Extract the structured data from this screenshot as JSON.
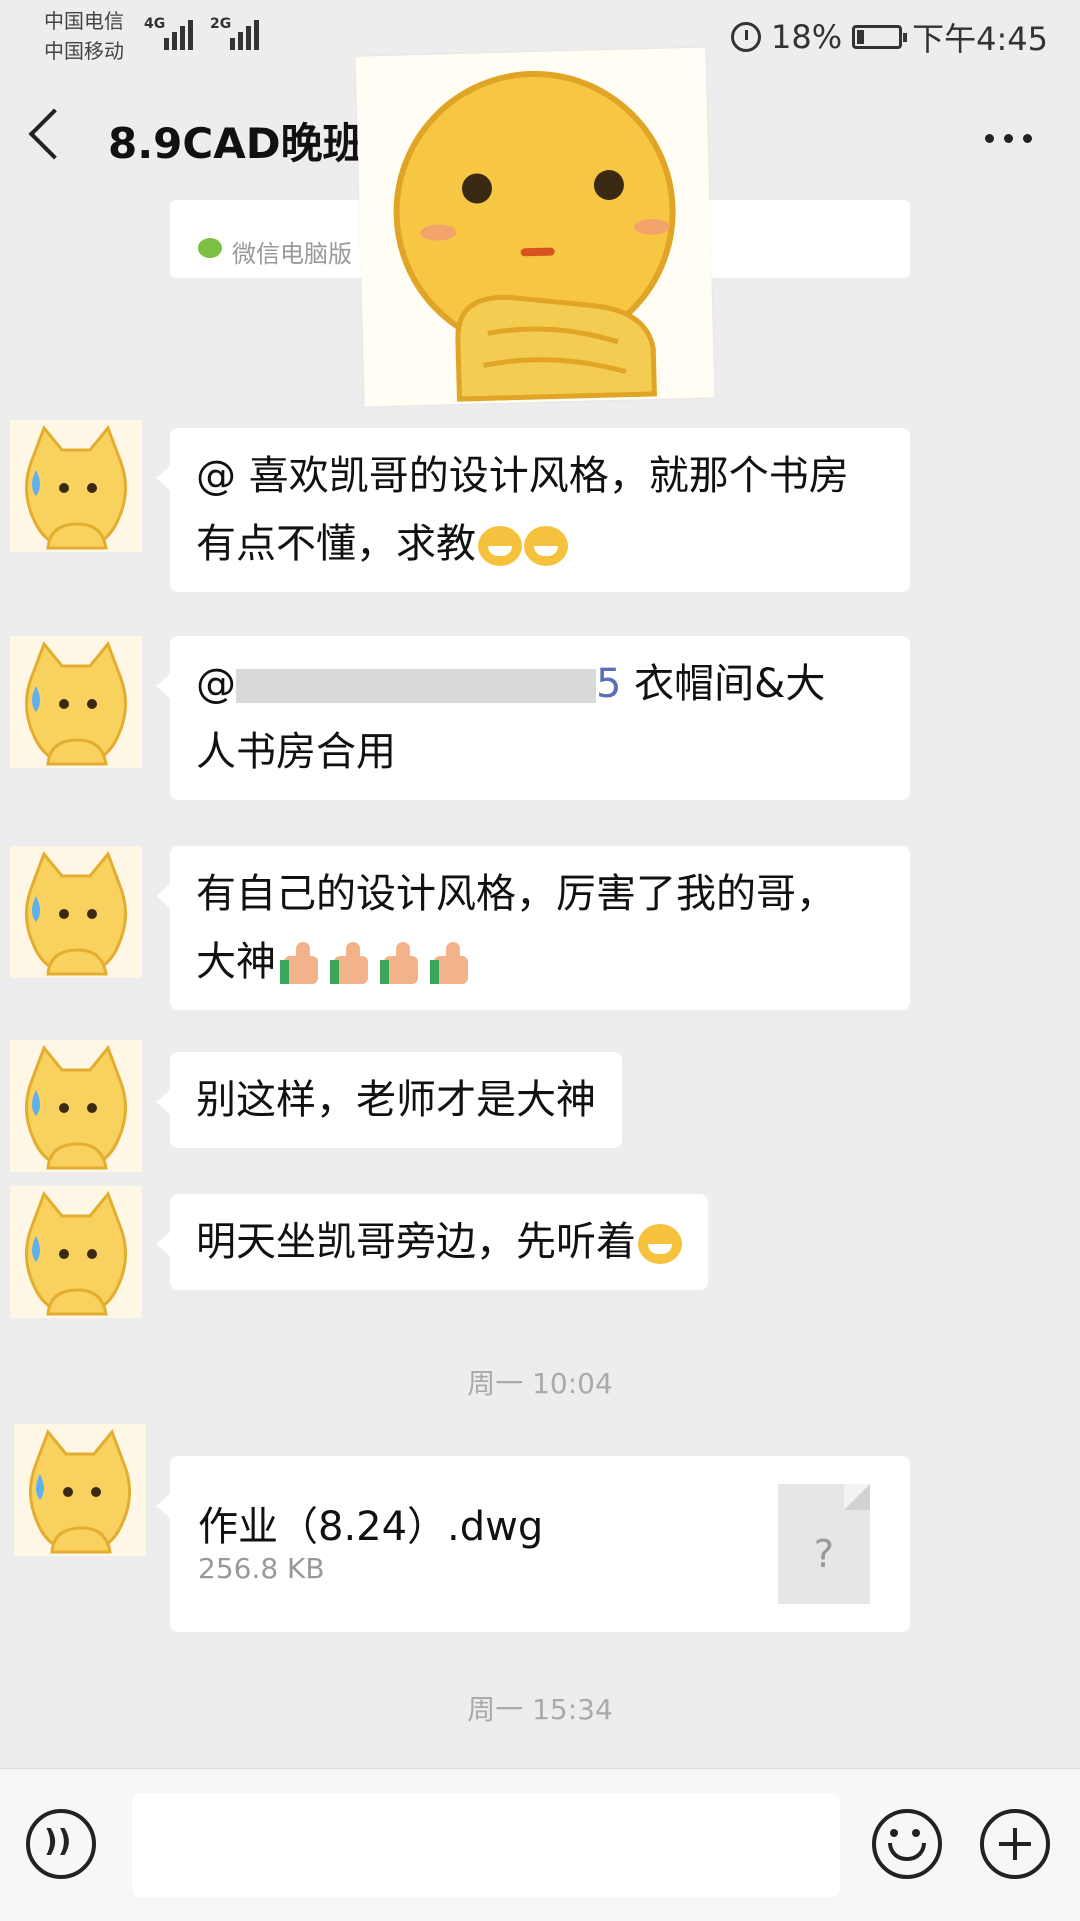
{
  "status_bar": {
    "carrier1": "中国电信",
    "carrier2": "中国移动",
    "net1": "4G",
    "net2": "2G",
    "battery_percent": "18%",
    "battery_level": 0.18,
    "time": "下午4:45"
  },
  "header": {
    "title": "8.9CAD晚班"
  },
  "top_card": {
    "text": "微信电脑版"
  },
  "messages": [
    {
      "text": "@ 喜欢凯哥的设计风格，就那个书房有点不懂，求教"
    },
    {
      "line1_mention": "@",
      "line1_mid": "5",
      "line1_end": "衣帽间&大",
      "line2": "人书房合用"
    },
    {
      "line1": "有自己的设计风格，厉害了我的哥，",
      "line2": "大神"
    },
    {
      "text": "别这样，老师才是大神"
    },
    {
      "text": "明天坐凯哥旁边，先听着"
    }
  ],
  "timestamps": [
    "周一 10:04",
    "周一 15:34"
  ],
  "file": {
    "name": "作业（8.24）.dwg",
    "size": "256.8 KB",
    "icon_glyph": "?"
  },
  "input_bar": {
    "voice_icon": "voice-icon",
    "emoji_icon": "emoji-icon",
    "plus_icon": "plus-icon"
  },
  "colors": {
    "background": "#ededed",
    "bubble": "#ffffff",
    "timestamp": "#aaaaaa",
    "wechat_green": "#7bc043"
  }
}
